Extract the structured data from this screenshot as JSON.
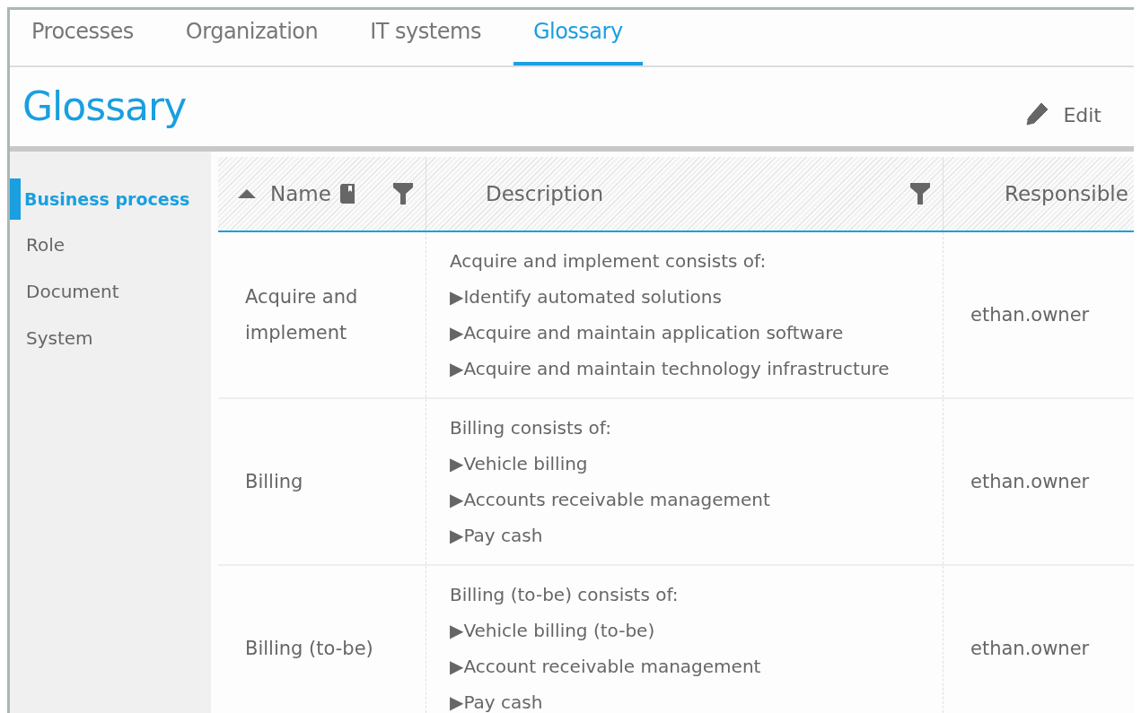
{
  "tabs": [
    {
      "label": "Processes",
      "selected": false
    },
    {
      "label": "Organization",
      "selected": false
    },
    {
      "label": "IT systems",
      "selected": false
    },
    {
      "label": "Glossary",
      "selected": true
    }
  ],
  "page": {
    "title": "Glossary",
    "edit_button": "Edit"
  },
  "sidebar": {
    "items": [
      {
        "label": "Business process",
        "selected": true
      },
      {
        "label": "Role",
        "selected": false
      },
      {
        "label": "Document",
        "selected": false
      },
      {
        "label": "System",
        "selected": false
      }
    ]
  },
  "table": {
    "columns": [
      {
        "label": "Name",
        "sorted": true,
        "book_icon": true,
        "filter": true
      },
      {
        "label": "Description",
        "sorted": false,
        "book_icon": false,
        "filter": true
      },
      {
        "label": "Responsible",
        "sorted": false
      }
    ],
    "rows": [
      {
        "name": "Acquire and implement",
        "description": {
          "intro": "Acquire and implement consists of:",
          "items": [
            "▶Identify automated solutions",
            "▶Acquire and maintain application software",
            "▶Acquire and maintain technology infrastructure"
          ]
        },
        "responsible": "ethan.owner"
      },
      {
        "name": "Billing",
        "description": {
          "intro": "Billing consists of:",
          "items": [
            "▶Vehicle billing",
            "▶Accounts receivable management",
            "▶Pay cash"
          ]
        },
        "responsible": "ethan.owner"
      },
      {
        "name": "Billing (to-be)",
        "description": {
          "intro": "Billing (to-be) consists of:",
          "items": [
            "▶Vehicle billing (to-be)",
            "▶Account receivable management",
            "▶Pay cash"
          ]
        },
        "responsible": "ethan.owner"
      }
    ]
  }
}
